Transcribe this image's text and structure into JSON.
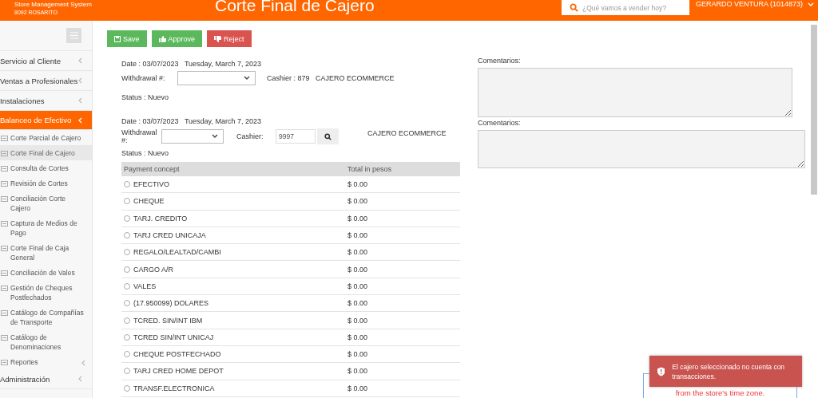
{
  "header": {
    "app_name": "Store Management System",
    "store": "8092 ROSARITO",
    "title": "Corte Final de Cajero",
    "search": {
      "placeholder": "¿Qué vamos a vender hoy?"
    },
    "user": "GERARDO VENTURA (1014873)"
  },
  "sidebar": {
    "items": [
      {
        "label": "Servicio al Cliente",
        "expanded": false
      },
      {
        "label": "Ventas a Profesionales",
        "expanded": false
      },
      {
        "label": "Instalaciones",
        "expanded": false
      },
      {
        "label": "Balanceo de Efectivo",
        "expanded": true,
        "children": [
          {
            "label": "Corte Parcial de Cajero",
            "selected": false,
            "expandable": false
          },
          {
            "label": "Corte Final de Cajero",
            "selected": true,
            "expandable": false
          },
          {
            "label": "Consulta de Cortes",
            "selected": false,
            "expandable": false
          },
          {
            "label": "Revisión de Cortes",
            "selected": false,
            "expandable": false
          },
          {
            "label": "Conciliación Corte Cajero",
            "selected": false,
            "expandable": false
          },
          {
            "label": "Captura de Medios de Pago",
            "selected": false,
            "expandable": false
          },
          {
            "label": "Corte Final de Caja General",
            "selected": false,
            "expandable": false
          },
          {
            "label": "Conciliación de Vales",
            "selected": false,
            "expandable": false
          },
          {
            "label": "Gestión de Cheques Postfechados",
            "selected": false,
            "expandable": false
          },
          {
            "label": "Catálogo de Compañías de Transporte",
            "selected": false,
            "expandable": false
          },
          {
            "label": "Catálogo de Denominaciones",
            "selected": false,
            "expandable": false
          },
          {
            "label": "Reportes",
            "selected": false,
            "expandable": true
          }
        ]
      },
      {
        "label": "Administración",
        "expanded": false
      }
    ]
  },
  "toolbar": {
    "buttons": [
      {
        "label": "Save",
        "kind": "save"
      },
      {
        "label": "Approve",
        "kind": "approve"
      },
      {
        "label": "Reject",
        "kind": "reject"
      }
    ]
  },
  "form_1": {
    "date_label": "Date :",
    "date": "03/07/2023",
    "date_long": "Tuesday, March 7, 2023",
    "withdrawal_label": "Withdrawal #:",
    "cashier_label": "Cashier :",
    "cashier_id": "879",
    "cashier_name": "CAJERO ECOMMERCE",
    "status_label": "Status :",
    "status": "Nuevo",
    "comments_label": "Comentarios:"
  },
  "form_2": {
    "date_label": "Date :",
    "date": "03/07/2023",
    "date_long": "Tuesday, March 7, 2023",
    "withdrawal_label": "Withdrawal #:",
    "cashier_label": "Cashier:",
    "cashier_value": "9997",
    "cashier_name": "CAJERO ECOMMERCE",
    "status_label": "Status :",
    "status": "Nuevo",
    "comments_label": "Comentarios:"
  },
  "table": {
    "columns": [
      "Payment concept",
      "Total in pesos"
    ],
    "rows": [
      {
        "concept": "EFECTIVO",
        "total": "$ 0.00",
        "selected": false
      },
      {
        "concept": "CHEQUE",
        "total": "$ 0.00",
        "selected": false
      },
      {
        "concept": "TARJ. CREDITO",
        "total": "$ 0.00",
        "selected": false
      },
      {
        "concept": "TARJ CRED UNICAJA",
        "total": "$ 0.00",
        "selected": false
      },
      {
        "concept": "REGALO/LEALTAD/CAMBI",
        "total": "$ 0.00",
        "selected": false
      },
      {
        "concept": "CARGO A/R",
        "total": "$ 0.00",
        "selected": false
      },
      {
        "concept": "VALES",
        "total": "$ 0.00",
        "selected": false
      },
      {
        "concept": "(17.950099) DOLARES",
        "total": "$ 0.00",
        "selected": false
      },
      {
        "concept": "TCRED. SIN/INT IBM",
        "total": "$ 0.00",
        "selected": false
      },
      {
        "concept": "TCRED SIN/INT UNICAJ",
        "total": "$ 0.00",
        "selected": false
      },
      {
        "concept": "CHEQUE POSTFECHADO",
        "total": "$ 0.00",
        "selected": false
      },
      {
        "concept": "TARJ CRED HOME DEPOT",
        "total": "$ 0.00",
        "selected": false
      },
      {
        "concept": "TRANSF.ELECTRONICA",
        "total": "$ 0.00",
        "selected": false
      }
    ]
  },
  "toast": {
    "message": "El cajero seleccionado no cuenta con transacciones."
  },
  "warning": {
    "text": "from the store's time zone."
  }
}
